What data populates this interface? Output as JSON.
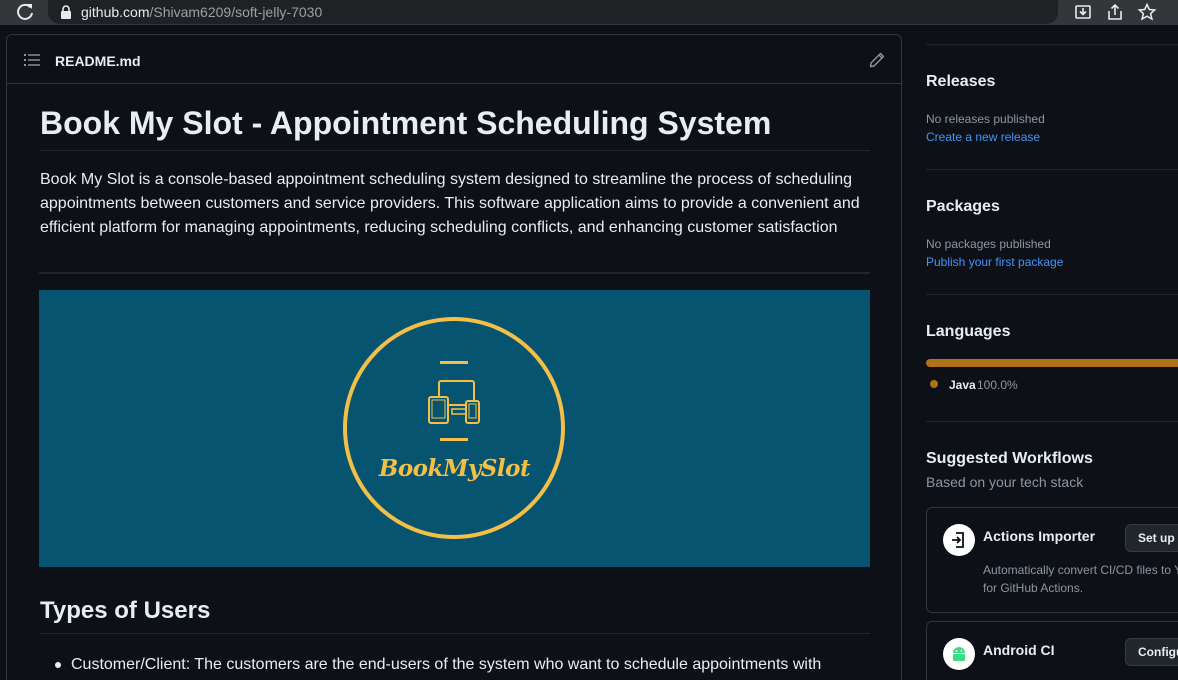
{
  "browser": {
    "url_host": "github.com",
    "url_path": "/Shivam6209/soft-jelly-7030"
  },
  "readme": {
    "filename": "README.md",
    "title": "Book My Slot - Appointment Scheduling System",
    "intro": "Book My Slot is a console-based appointment scheduling system designed to streamline the process of scheduling appointments between customers and service providers. This software application aims to provide a convenient and efficient platform for managing appointments, reducing scheduling conflicts, and enhancing customer satisfaction",
    "banner_logo_text": "BookMySlot",
    "banner_bg": "#065470",
    "banner_accent": "#f3bf47",
    "section_heading": "Types of Users",
    "list_items": [
      "Customer/Client: The customers are the end-users of the system who want to schedule appointments with"
    ]
  },
  "sidebar": {
    "releases": {
      "heading": "Releases",
      "status": "No releases published",
      "link": "Create a new release"
    },
    "packages": {
      "heading": "Packages",
      "status": "No packages published",
      "link": "Publish your first package"
    },
    "languages": {
      "heading": "Languages",
      "items": [
        {
          "name": "Java",
          "percent": "100.0%",
          "share": 1.0,
          "color": "#b07219"
        }
      ]
    },
    "workflows": {
      "heading": "Suggested Workflows",
      "subtitle": "Based on your tech stack",
      "items": [
        {
          "title": "Actions Importer",
          "desc_line1": "Automatically convert CI/CD files to Y",
          "desc_line2": "for GitHub Actions.",
          "button": "Set up",
          "icon": "actions-importer-icon"
        },
        {
          "title": "Android CI",
          "button": "Configure",
          "icon": "android-icon"
        }
      ]
    }
  },
  "colors": {
    "bg": "#0d1117",
    "border": "#30363d",
    "link": "#4493f8",
    "muted": "#8d96a0"
  }
}
